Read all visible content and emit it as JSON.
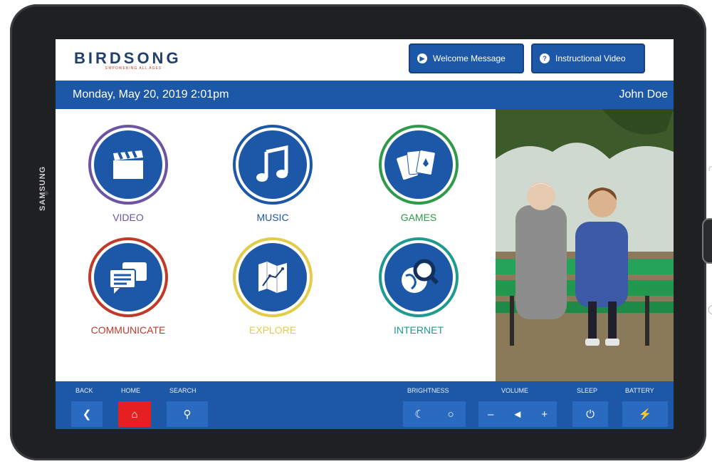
{
  "device": {
    "brand": "SAMSUNG"
  },
  "header": {
    "logo": "BIRDSONG",
    "tagline": "EMPOWERING ALL AGES",
    "welcome_button": "Welcome Message",
    "instructional_button": "Instructional Video"
  },
  "status": {
    "date": "Monday, May 20, 2019  2:01pm",
    "user": "John Doe"
  },
  "tiles": [
    {
      "label": "VIDEO",
      "color": "#6b55a3"
    },
    {
      "label": "MUSIC",
      "color": "#1d58a8"
    },
    {
      "label": "GAMES",
      "color": "#2f9a4a"
    },
    {
      "label": "COMMUNICATE",
      "color": "#c0392b"
    },
    {
      "label": "EXPLORE",
      "color": "#e2cc4a"
    },
    {
      "label": "INTERNET",
      "color": "#1f9a8e"
    }
  ],
  "footer": {
    "back_label": "BACK",
    "home_label": "HOME",
    "search_label": "SEARCH",
    "brightness_label": "BRIGHTNESS",
    "volume_label": "VOLUME",
    "sleep_label": "SLEEP",
    "battery_label": "BATTERY"
  },
  "icons": {
    "back": "chevron-left-icon",
    "home": "home-icon",
    "search": "search-icon",
    "brightness_down": "moon-icon",
    "brightness_up": "sun-icon",
    "volume_down": "minus-icon",
    "volume": "speaker-icon",
    "volume_up": "plus-icon",
    "sleep": "power-icon",
    "battery": "battery-charging-icon"
  },
  "colors": {
    "primary": "#1d58a8",
    "home_active": "#e62020",
    "button": "#2a6ac1"
  }
}
